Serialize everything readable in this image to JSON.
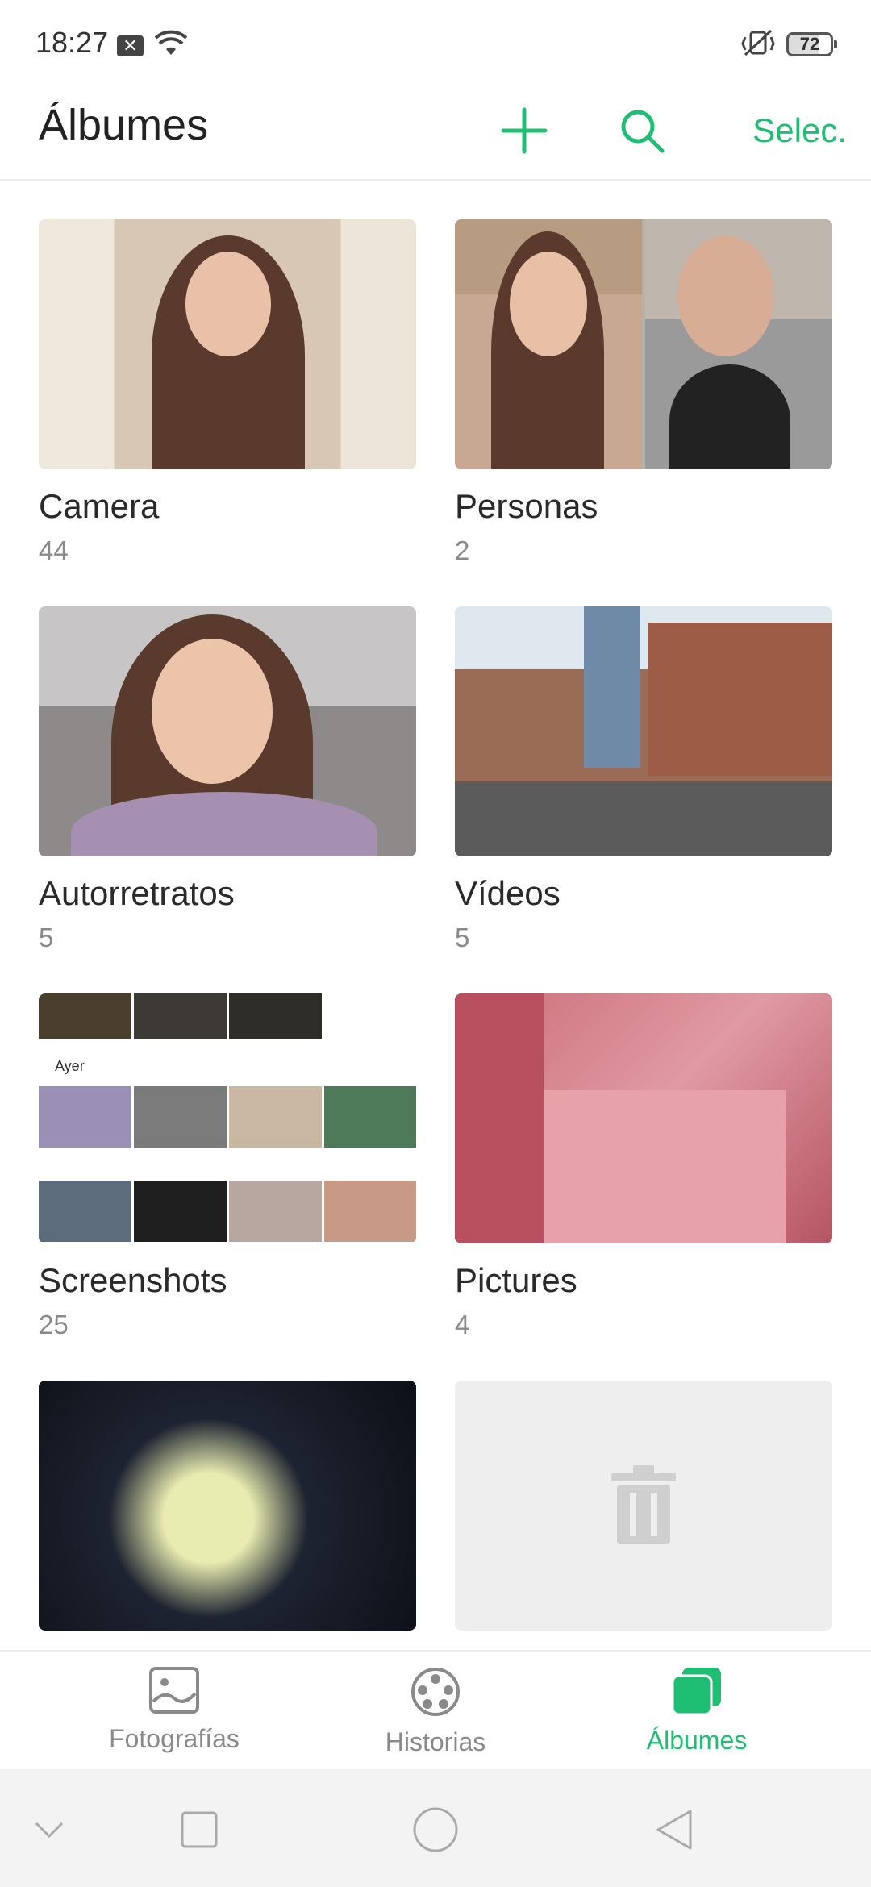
{
  "status_bar": {
    "time": "18:27",
    "notification_icon": "x-box-icon",
    "wifi_icon": "wifi-icon",
    "vibrate_icon": "vibrate-icon",
    "battery_level": "72"
  },
  "header": {
    "title": "Álbumes",
    "add_icon": "plus-icon",
    "search_icon": "search-icon",
    "select_label": "Selec."
  },
  "albums": [
    {
      "name": "Camera",
      "count": "44"
    },
    {
      "name": "Personas",
      "count": "2"
    },
    {
      "name": "Autorretratos",
      "count": "5"
    },
    {
      "name": "Vídeos",
      "count": "5"
    },
    {
      "name": "Screenshots",
      "count": "25"
    },
    {
      "name": "Pictures",
      "count": "4"
    }
  ],
  "screenshot_thumb_label": "Ayer",
  "bottom_nav": {
    "items": [
      {
        "label": "Fotografías",
        "icon": "photo-icon"
      },
      {
        "label": "Historias",
        "icon": "film-reel-icon"
      },
      {
        "label": "Álbumes",
        "icon": "albums-icon"
      }
    ],
    "active": "Álbumes"
  },
  "colors": {
    "accent": "#1fbf73",
    "muted_text": "#8a8a8a"
  }
}
